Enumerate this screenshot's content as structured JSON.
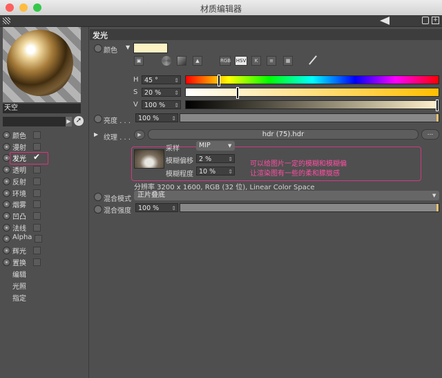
{
  "window": {
    "title": "材质编辑器"
  },
  "left": {
    "material_name": "天空",
    "channels": [
      {
        "label": "颜色",
        "checked": false
      },
      {
        "label": "漫射",
        "checked": false
      },
      {
        "label": "发光",
        "checked": true,
        "highlight": true
      },
      {
        "label": "透明",
        "checked": false
      },
      {
        "label": "反射",
        "checked": false
      },
      {
        "label": "环境",
        "checked": false
      },
      {
        "label": "烟雾",
        "checked": false
      },
      {
        "label": "凹凸",
        "checked": false
      },
      {
        "label": "法线",
        "checked": false
      },
      {
        "label": "Alpha",
        "checked": false
      },
      {
        "label": "辉光",
        "checked": false
      },
      {
        "label": "置换",
        "checked": false
      }
    ],
    "extra_items": [
      "编辑",
      "光照",
      "指定"
    ],
    "checkmark": "✔"
  },
  "section": {
    "title": "发光"
  },
  "color": {
    "label": "颜色",
    "swatch": "#fdf2c4",
    "modes": [
      "RGB",
      "HSV",
      "K"
    ],
    "active_mode": "HSV",
    "h_label": "H",
    "h_value": "45 °",
    "h_fraction": 0.125,
    "s_label": "S",
    "s_value": "20 %",
    "s_fraction": 0.2,
    "v_label": "V",
    "v_value": "100 %",
    "v_fraction": 1.0
  },
  "brightness": {
    "label": "亮度 . . .",
    "value": "100 %",
    "fraction": 1.0
  },
  "texture": {
    "label": "纹理 . . .",
    "file": "hdr (75).hdr",
    "more": "...",
    "sampling_label": "采样",
    "sampling_value": "MIP",
    "blur_offset_label": "模糊偏移",
    "blur_offset_value": "2 %",
    "blur_scale_label": "模糊程度",
    "blur_scale_value": "10 %",
    "resolution": "分辨率 3200 x 1600, RGB (32 位), Linear Color Space",
    "note_line1": "可以给图片一定的模糊和模糊偏",
    "note_line2": "让渲染图有一些的柔和朦胧感"
  },
  "mix_mode": {
    "label": "混合模式",
    "value": "正片叠底"
  },
  "mix_strength": {
    "label": "混合强度",
    "value": "100 %",
    "fraction": 1.0
  }
}
